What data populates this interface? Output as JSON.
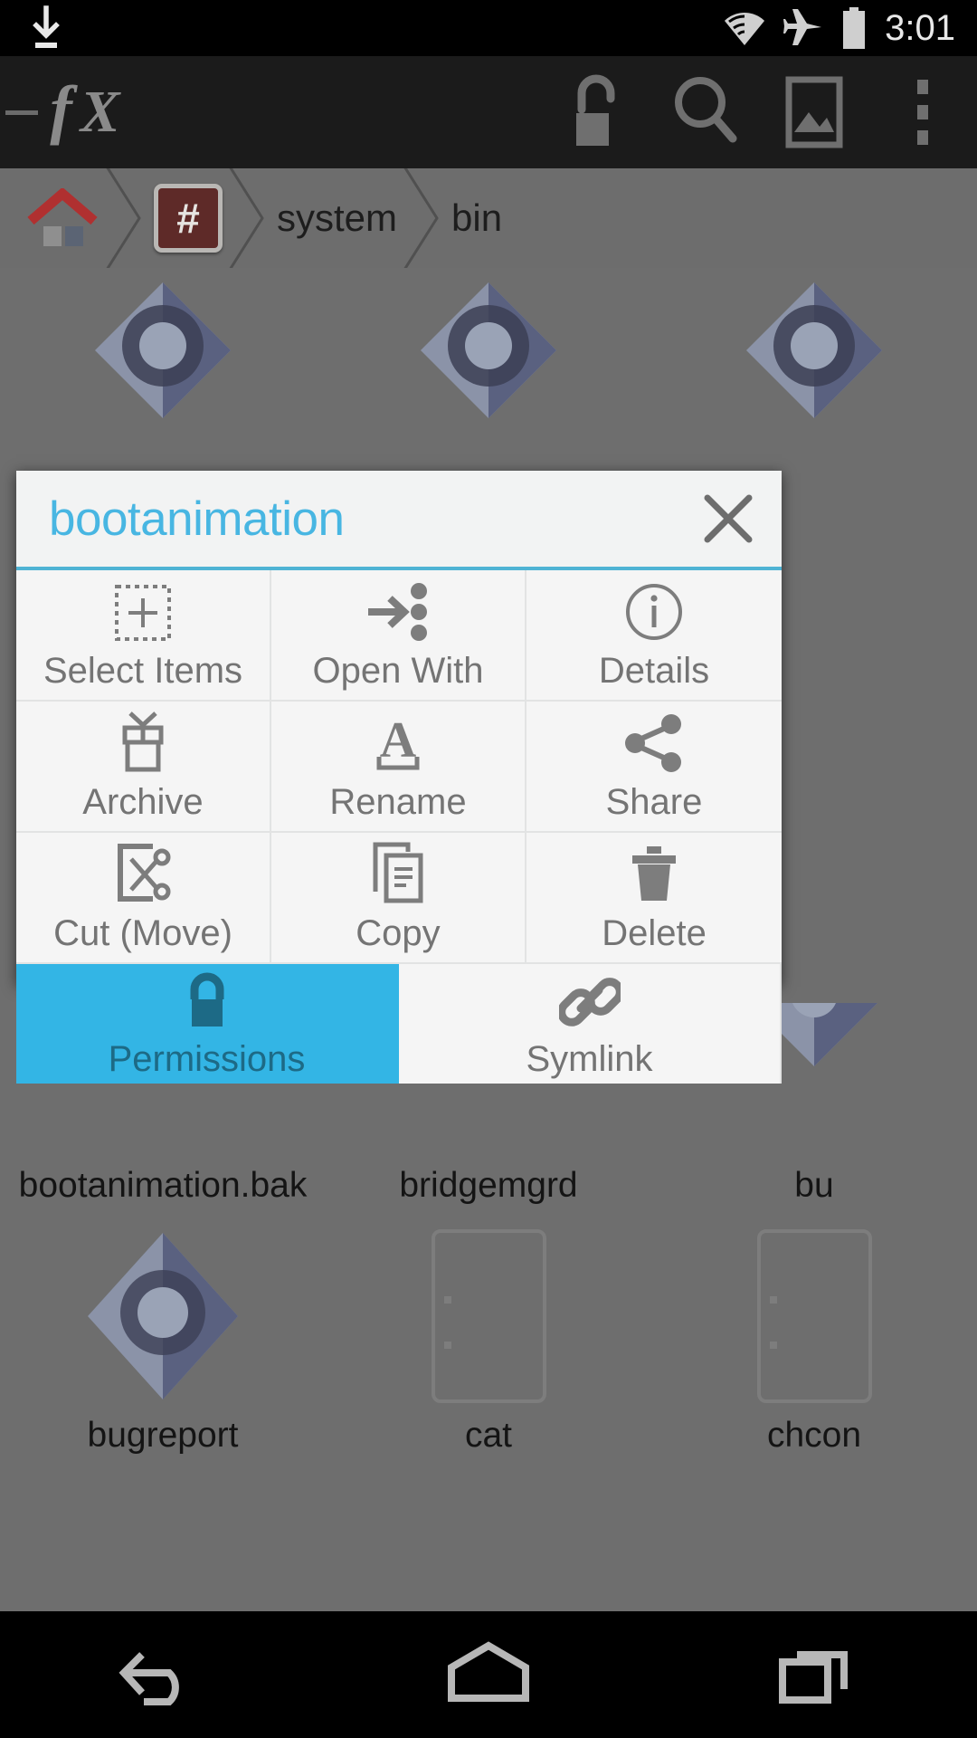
{
  "status_bar": {
    "time": "3:01",
    "icons": [
      "download-icon",
      "wifi-icon",
      "airplane-mode-icon",
      "battery-icon"
    ]
  },
  "action_bar": {
    "app_logo": "fx",
    "up_label": "—",
    "icons": [
      "unlock-icon",
      "search-icon",
      "image-icon",
      "overflow-menu-icon"
    ]
  },
  "breadcrumb": {
    "items": [
      {
        "label": "",
        "icon": "home-icon"
      },
      {
        "label": "#",
        "icon": "root-icon"
      },
      {
        "label": "system",
        "icon": ""
      },
      {
        "label": "bin",
        "icon": ""
      }
    ]
  },
  "dialog": {
    "title": "bootanimation",
    "close_label": "×",
    "accent_color": "#4fb3d4",
    "title_color": "#48b6e2",
    "selected_color": "#33b5e5",
    "actions": [
      {
        "label": "Select Items",
        "icon": "select-items-icon",
        "selected": false
      },
      {
        "label": "Open With",
        "icon": "open-with-icon",
        "selected": false
      },
      {
        "label": "Details",
        "icon": "info-icon",
        "selected": false
      },
      {
        "label": "Archive",
        "icon": "archive-icon",
        "selected": false
      },
      {
        "label": "Rename",
        "icon": "rename-icon",
        "selected": false
      },
      {
        "label": "Share",
        "icon": "share-icon",
        "selected": false
      },
      {
        "label": "Cut (Move)",
        "icon": "cut-icon",
        "selected": false
      },
      {
        "label": "Copy",
        "icon": "copy-icon",
        "selected": false
      },
      {
        "label": "Delete",
        "icon": "trash-icon",
        "selected": false
      },
      {
        "label": "Permissions",
        "icon": "lock-icon",
        "selected": true
      },
      {
        "label": "Symlink",
        "icon": "link-icon",
        "selected": false
      }
    ]
  },
  "file_grid": {
    "rows": [
      [
        {
          "name": "",
          "icon": "gear-file-icon"
        },
        {
          "name": "",
          "icon": "gear-file-icon"
        },
        {
          "name": "",
          "icon": "gear-file-icon"
        }
      ],
      [
        {
          "name": "bootanimation.bak",
          "icon": "gear-file-icon"
        },
        {
          "name": "bridgemgrd",
          "icon": "gear-file-icon"
        },
        {
          "name": "bu",
          "icon": "gear-file-icon"
        }
      ],
      [
        {
          "name": "bugreport",
          "icon": "gear-file-icon"
        },
        {
          "name": "cat",
          "icon": "document-file-icon"
        },
        {
          "name": "chcon",
          "icon": "document-file-icon"
        }
      ]
    ]
  },
  "nav_bar": {
    "buttons": [
      {
        "label": "Back",
        "icon": "back-icon"
      },
      {
        "label": "Home",
        "icon": "home-nav-icon"
      },
      {
        "label": "Recents",
        "icon": "recents-icon"
      }
    ]
  }
}
